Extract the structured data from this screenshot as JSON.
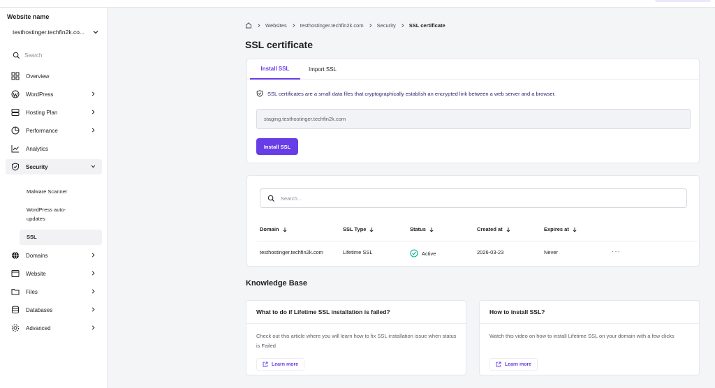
{
  "colors": {
    "accent": "#673de6",
    "success": "#00b090",
    "text": "#1d1e20",
    "muted": "#5b5d66",
    "background": "#f4f5f7"
  },
  "sidebar": {
    "website_label": "Website name",
    "website_value": "testhostinger.techfin2k.co...",
    "search_placeholder": "Search",
    "items": [
      {
        "label": "Overview",
        "icon": "grid-icon"
      },
      {
        "label": "WordPress",
        "icon": "wordpress-icon"
      },
      {
        "label": "Hosting Plan",
        "icon": "server-icon"
      },
      {
        "label": "Performance",
        "icon": "pie-chart-icon"
      },
      {
        "label": "Analytics",
        "icon": "trend-icon"
      },
      {
        "label": "Security",
        "icon": "shield-icon"
      },
      {
        "label": "Domains",
        "icon": "globe-icon"
      },
      {
        "label": "Website",
        "icon": "window-icon"
      },
      {
        "label": "Files",
        "icon": "folder-icon"
      },
      {
        "label": "Databases",
        "icon": "database-icon"
      },
      {
        "label": "Advanced",
        "icon": "gear-icon"
      }
    ],
    "security_sub": [
      "Malware Scanner",
      "WordPress auto-",
      "updates",
      "SSL"
    ]
  },
  "breadcrumb": [
    "Websites",
    "testhostinger.techfin2k.com",
    "Security",
    "SSL certificate"
  ],
  "page_title": "SSL certificate",
  "tabs": [
    "Install SSL",
    "Import SSL"
  ],
  "install": {
    "info": "SSL certificates are a small data files that cryptographically establish an encrypted link between a web server and a browser.",
    "domain_value": "staging.testhostinger.techfin2k.com",
    "button": "Install SSL"
  },
  "table": {
    "search_placeholder": "Search...",
    "columns": [
      "Domain",
      "SSL Type",
      "Status",
      "Created at",
      "Expires at"
    ],
    "rows": [
      {
        "domain": "testhostinger.techfin2k.com",
        "type": "Lifetime SSL",
        "status": "Active",
        "created": "2026-03-23",
        "expires": "Never",
        "more": "···"
      }
    ]
  },
  "knowledge_base": {
    "title": "Knowledge Base",
    "cards": [
      {
        "title": "What to do if Lifetime SSL installation is failed?",
        "body": "Check out this article where you will learn how to fix SSL installation issue when status is Failed",
        "link": "Learn more"
      },
      {
        "title": "How to install SSL?",
        "body": "Watch this video on how to install Lifetime SSL on your domain with a few clicks",
        "link": "Learn more"
      }
    ]
  }
}
